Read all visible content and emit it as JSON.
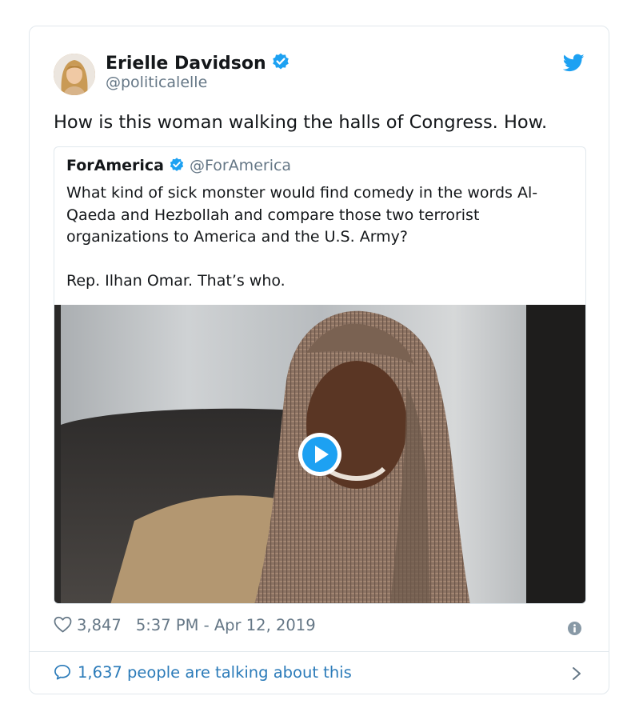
{
  "tweet": {
    "author_name": "Erielle Davidson",
    "author_handle": "@politicalelle",
    "text": "How is this woman walking the halls of Congress. How.",
    "likes": "3,847",
    "timestamp": "5:37 PM - Apr 12, 2019",
    "talking": "1,637 people are talking about this"
  },
  "quoted": {
    "name": "ForAmerica",
    "handle": "@ForAmerica",
    "text1": "What kind of sick monster would find comedy in the words Al-Qaeda and Hezbollah and compare those two terrorist organizations to America and the U.S. Army?",
    "text2": "Rep. Ilhan Omar. That’s who."
  },
  "icons": [
    "verified-badge",
    "twitter-bird",
    "play",
    "heart",
    "info",
    "speech-bubble",
    "chevron-right"
  ],
  "colors": {
    "brand_blue": "#1da1f2",
    "link_blue": "#2b7bb9",
    "muted": "#657786",
    "border": "#e1e8ed"
  }
}
